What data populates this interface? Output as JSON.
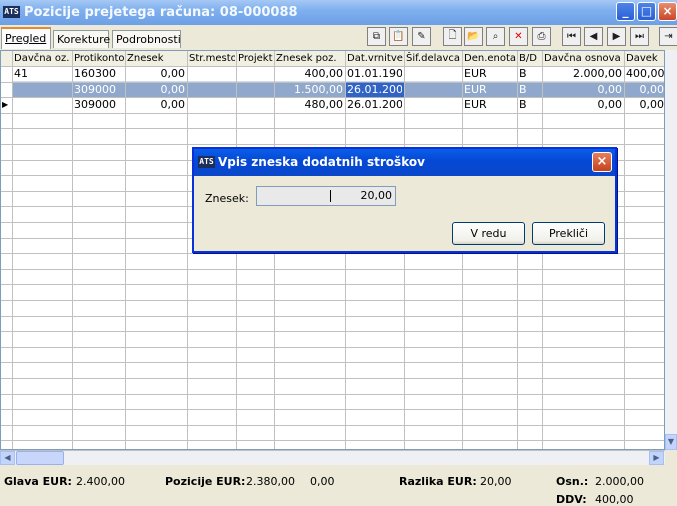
{
  "window": {
    "title": "Pozicije prejetega računa: 08-000088",
    "logo": "ATS"
  },
  "tabs": [
    "Pregled",
    "Korekture",
    "Podrobnosti"
  ],
  "toolbar_icons": [
    "copy-icon",
    "paste-icon",
    "edit-icon",
    "new-document-icon",
    "open-folder-icon",
    "find-icon",
    "delete-icon",
    "print-icon",
    "first-record-icon",
    "previous-record-icon",
    "next-record-icon",
    "last-record-icon",
    "exit-icon"
  ],
  "grid": {
    "columns": [
      "Davčna oz.",
      "Protikonto",
      "Znesek",
      "Str.mesto",
      "Projekt",
      "Znesek poz.",
      "Dat.vrnitve",
      "Šif.delavca",
      "Den.enota",
      "B/D",
      "Davčna osnova",
      "Davek"
    ],
    "rows": [
      {
        "davcna_oz": "41",
        "protikonto": "160300",
        "znesek": "0,00",
        "str_mesto": "",
        "projekt": "",
        "znesek_poz": "400,00",
        "dat_vrnitve": "01.01.190(",
        "sif_delavca": "",
        "den_enota": "EUR",
        "bd": "B",
        "davcna_osnova": "2.000,00",
        "davek": "400,00"
      },
      {
        "davcna_oz": "",
        "protikonto": "309000",
        "znesek": "0,00",
        "str_mesto": "",
        "projekt": "",
        "znesek_poz": "1.500,00",
        "dat_vrnitve": "26.01.200",
        "sif_delavca": "",
        "den_enota": "EUR",
        "bd": "B",
        "davcna_osnova": "0,00",
        "davek": "0,00"
      },
      {
        "davcna_oz": "",
        "protikonto": "309000",
        "znesek": "0,00",
        "str_mesto": "",
        "projekt": "",
        "znesek_poz": "480,00",
        "dat_vrnitve": "26.01.200",
        "sif_delavca": "",
        "den_enota": "EUR",
        "bd": "B",
        "davcna_osnova": "0,00",
        "davek": "0,00"
      }
    ],
    "selected_row_index": 1,
    "current_row_index": 2
  },
  "summary": {
    "glava_label": "Glava EUR:",
    "glava_value": "2.400,00",
    "pozicije_label": "Pozicije EUR:",
    "pozicije_value": "2.380,00",
    "pozicije_extra": "0,00",
    "razlika_label": "Razlika EUR:",
    "razlika_value": "20,00",
    "osn_label": "Osn.:",
    "osn_value": "2.000,00",
    "ddv_label": "DDV:",
    "ddv_value": "400,00"
  },
  "dialog": {
    "title": "Vpis zneska dodatnih stroškov",
    "field_label": "Znesek:",
    "field_value": "20,00",
    "ok_label": "V redu",
    "cancel_label": "Prekliči"
  },
  "colors": {
    "title_bar": "#7fb0ee",
    "dialog_title_bar": "#0548d6",
    "selected_row": "#8fa8cc",
    "active_tab_accent": "#e68b2c"
  }
}
